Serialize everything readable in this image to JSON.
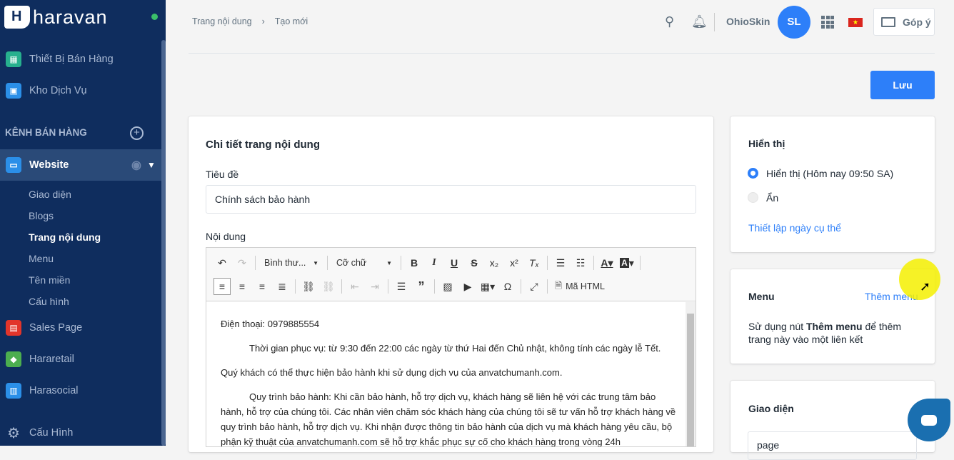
{
  "sidebar": {
    "brand": "haravan",
    "items": [
      {
        "label": "Thiết Bị Bán Hàng"
      },
      {
        "label": "Kho Dịch Vụ"
      }
    ],
    "section": "KÊNH BÁN HÀNG",
    "channel": "Website",
    "sub": [
      "Giao diện",
      "Blogs",
      "Trang nội dung",
      "Menu",
      "Tên miền",
      "Cấu hình"
    ],
    "channels": [
      "Sales Page",
      "Hararetail",
      "Harasocial"
    ],
    "settings": "Cấu Hình"
  },
  "header": {
    "breadcrumb": [
      "Trang nội dung",
      "Tạo mới"
    ],
    "shop": "OhioSkin",
    "avatar": "SL",
    "feedback": "Góp ý"
  },
  "save_label": "Lưu",
  "main": {
    "title": "Chi tiết trang nội dung",
    "title_label": "Tiêu đề",
    "title_value": "Chính sách bảo hành",
    "content_label": "Nội dung",
    "toolbar": {
      "format": "Bình thư...",
      "size": "Cỡ chữ",
      "html": "Mã HTML"
    },
    "paragraphs": [
      "Điện thoại: 0979885554",
      "Thời gian phục vụ: từ 9:30 đến 22:00 các ngày từ thứ Hai đến Chủ nhật, không tính các ngày lễ Tết.",
      "Quý khách có thể thực hiện bảo hành khi sử dụng dịch vụ của anvatchumanh.com.",
      "Quy trình bảo hành: Khi cần bảo hành, hỗ trợ dịch vụ, khách hàng sẽ liên hệ với các trung tâm bảo hành, hỗ trợ của chúng tôi. Các nhân viên chăm sóc khách hàng của chúng tôi sẽ tư vấn hỗ trợ khách hàng về quy trình bảo hành, hỗ trợ dịch vụ. Khi nhận được thông tin bảo hành của dịch vụ mà khách hàng yêu cầu, bộ phận kỹ thuật của anvatchumanh.com sẽ hỗ trợ khắc phục sự cố cho khách hàng trong vòng 24h"
    ]
  },
  "visibility": {
    "title": "Hiển thị",
    "options": [
      "Hiển thị (Hôm nay 09:50 SA)",
      "Ẩn"
    ],
    "selected": 0,
    "link": "Thiết lập ngày cụ thể"
  },
  "menu": {
    "title": "Menu",
    "add": "Thêm menu",
    "desc_pre": "Sử dụng nút ",
    "desc_bold": "Thêm menu",
    "desc_post": " để thêm trang này vào một liên kết"
  },
  "template": {
    "title": "Giao diện",
    "value": "page"
  },
  "colors": {
    "sidebar": "#0f2d5e",
    "accent": "#2d7ff9"
  }
}
